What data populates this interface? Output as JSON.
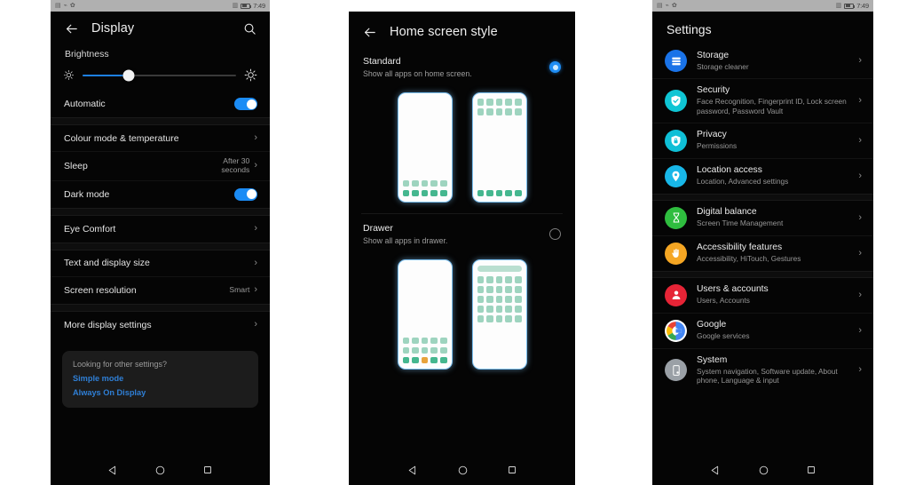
{
  "statusbar": {
    "left_icons": [
      "sim-card-icon",
      "usb-icon",
      "settings-gear-icon"
    ],
    "time": "7:49",
    "right_icons": [
      "vibrate-icon",
      "battery-icon"
    ]
  },
  "phone1": {
    "appbar": {
      "back": "back-arrow-icon",
      "title": "Display",
      "search": "search-icon"
    },
    "brightness": {
      "label": "Brightness",
      "value_percent": 30,
      "low_icon": "brightness-low-icon",
      "high_icon": "brightness-high-icon"
    },
    "automatic": {
      "label": "Automatic",
      "state": "on"
    },
    "rows_group1": [
      {
        "label": "Colour mode & temperature",
        "value": "",
        "type": "chevron"
      },
      {
        "label": "Sleep",
        "value": "After 30 seconds",
        "type": "chevron"
      },
      {
        "label": "Dark mode",
        "value": "",
        "type": "toggle",
        "state": "on"
      }
    ],
    "rows_group2": [
      {
        "label": "Eye Comfort",
        "value": "",
        "type": "chevron"
      }
    ],
    "rows_group3": [
      {
        "label": "Text and display size",
        "value": "",
        "type": "chevron"
      },
      {
        "label": "Screen resolution",
        "value": "Smart",
        "type": "chevron"
      }
    ],
    "rows_group4": [
      {
        "label": "More display settings",
        "value": "",
        "type": "chevron"
      }
    ],
    "card": {
      "question": "Looking for other settings?",
      "links": [
        "Simple mode",
        "Always On Display"
      ]
    }
  },
  "phone2": {
    "appbar": {
      "back": "back-arrow-icon",
      "title": "Home screen style"
    },
    "options": [
      {
        "title": "Standard",
        "subtitle": "Show all apps on home screen.",
        "selected": true,
        "previews": [
          {
            "name": "standard-home-empty",
            "search": false,
            "top_rows": 0,
            "bottom_rows": 2,
            "dock": false
          },
          {
            "name": "standard-home-apps",
            "search": false,
            "top_rows": 2,
            "bottom_rows": 0,
            "dock": true
          }
        ]
      },
      {
        "title": "Drawer",
        "subtitle": "Show all apps in drawer.",
        "selected": false,
        "previews": [
          {
            "name": "drawer-home",
            "search": false,
            "top_rows": 0,
            "bottom_rows": 2,
            "dock": true
          },
          {
            "name": "drawer-list",
            "search": true,
            "top_rows": 5,
            "bottom_rows": 0,
            "dock": false
          }
        ]
      }
    ]
  },
  "phone3": {
    "title": "Settings",
    "groups": [
      {
        "items": [
          {
            "title": "Storage",
            "subtitle": "Storage cleaner",
            "icon": "storage-icon",
            "color": "#1a73e8"
          },
          {
            "title": "Security",
            "subtitle": "Face Recognition, Fingerprint ID, Lock screen password, Password Vault",
            "icon": "shield-check-icon",
            "color": "#0fc5d4"
          },
          {
            "title": "Privacy",
            "subtitle": "Permissions",
            "icon": "privacy-lock-icon",
            "color": "#0fbfd6"
          },
          {
            "title": "Location access",
            "subtitle": "Location, Advanced settings",
            "icon": "location-pin-icon",
            "color": "#18b7e8"
          }
        ]
      },
      {
        "items": [
          {
            "title": "Digital balance",
            "subtitle": "Screen Time Management",
            "icon": "hourglass-icon",
            "color": "#2fbd3f"
          },
          {
            "title": "Accessibility features",
            "subtitle": "Accessibility, HiTouch, Gestures",
            "icon": "hand-icon",
            "color": "#f5a623"
          }
        ]
      },
      {
        "items": [
          {
            "title": "Users & accounts",
            "subtitle": "Users, Accounts",
            "icon": "person-icon",
            "color": "#e62436"
          },
          {
            "title": "Google",
            "subtitle": "Google services",
            "icon": "google-g-icon",
            "color": "#ffffff"
          },
          {
            "title": "System",
            "subtitle": "System navigation, Software update, About phone, Language & input",
            "icon": "phone-gear-icon",
            "color": "#9aa0a6"
          }
        ]
      }
    ]
  },
  "navbar": {
    "back": "nav-back-triangle-icon",
    "home": "nav-home-circle-icon",
    "recents": "nav-recents-square-icon"
  },
  "colors": {
    "accent_blue": "#1b8cf5",
    "link_blue": "#2f7fd6",
    "preview_green": "#45b78f",
    "preview_green_light": "#9ed4bf"
  }
}
